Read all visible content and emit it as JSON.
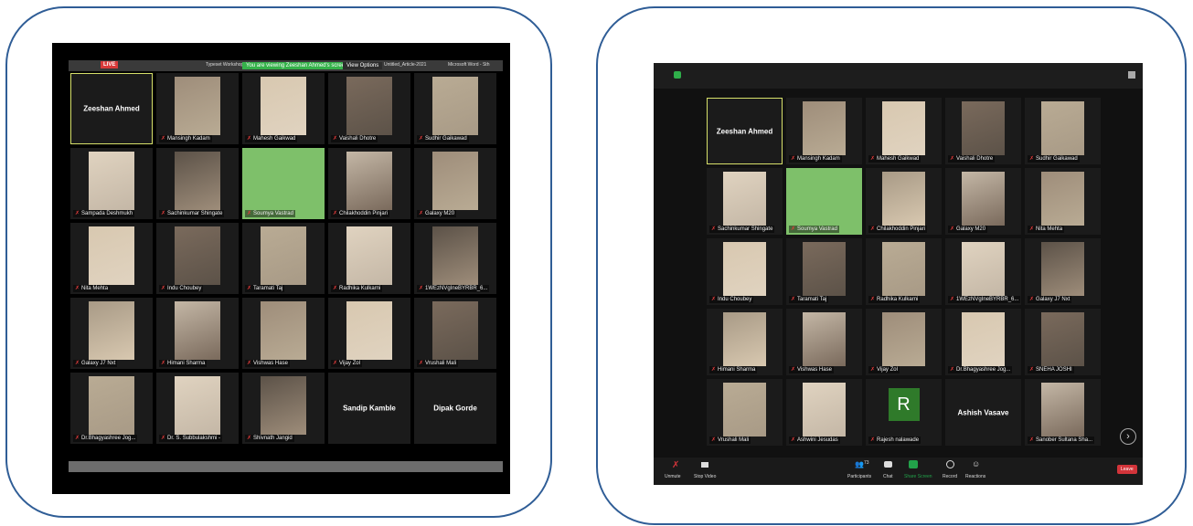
{
  "left": {
    "browser_tabs": [
      "LIVE",
      "Typeset Workshop",
      "Untitled_Article-2021",
      "Microsoft Word - Sth"
    ],
    "share_banner": "You are viewing Zeeshan Ahmed's screen",
    "view_options": "View Options",
    "tiles": [
      {
        "label": "Zeeshan Ahmed",
        "type": "name"
      },
      {
        "label": "Mansingh Kadam",
        "type": "video"
      },
      {
        "label": "Mahesh Gaikwad",
        "type": "video"
      },
      {
        "label": "Vaishali Dhotre",
        "type": "video"
      },
      {
        "label": "Sudhir Gaikawad",
        "type": "video"
      },
      {
        "label": "Sampada Deshmukh",
        "type": "video"
      },
      {
        "label": "Sachinkumar Shingate",
        "type": "video"
      },
      {
        "label": "Soumya Vastrad",
        "type": "green"
      },
      {
        "label": "Chilakhoddin Pinjari",
        "type": "video"
      },
      {
        "label": "Galaxy M20",
        "type": "video"
      },
      {
        "label": "Nita Mehta",
        "type": "video"
      },
      {
        "label": "Indu Choubey",
        "type": "video"
      },
      {
        "label": "Taramati Taj",
        "type": "video"
      },
      {
        "label": "Radhika Kulkarni",
        "type": "video"
      },
      {
        "label": "1WEzNVgIneBYRBR_6...",
        "type": "video"
      },
      {
        "label": "Galaxy J7 Nxt",
        "type": "video"
      },
      {
        "label": "Himani Sharma",
        "type": "video"
      },
      {
        "label": "Vishwas Hase",
        "type": "video"
      },
      {
        "label": "Vijay Zol",
        "type": "video"
      },
      {
        "label": "Vrushali Mali",
        "type": "video"
      },
      {
        "label": "Dr.Bhagyashree Jog...",
        "type": "video"
      },
      {
        "label": "Dr. S. Subbulakshmi -",
        "type": "video"
      },
      {
        "label": "Shivnath Jangid",
        "type": "video"
      },
      {
        "label": "Sandip Kamble",
        "type": "name"
      },
      {
        "label": "Dipak Gorde",
        "type": "name"
      }
    ]
  },
  "right": {
    "tiles": [
      {
        "label": "Zeeshan Ahmed",
        "type": "name"
      },
      {
        "label": "Mansingh Kadam",
        "type": "video"
      },
      {
        "label": "Mahesh Gaikwad",
        "type": "video"
      },
      {
        "label": "Vaishali Dhotre",
        "type": "video"
      },
      {
        "label": "Sudhir Gaikawad",
        "type": "video"
      },
      {
        "label": "Sachinkumar Shingate",
        "type": "video"
      },
      {
        "label": "Soumya Vastrad",
        "type": "green"
      },
      {
        "label": "Chilakhoddin Pinjari",
        "type": "video"
      },
      {
        "label": "Galaxy M20",
        "type": "video"
      },
      {
        "label": "Nita Mehta",
        "type": "video"
      },
      {
        "label": "Indu Choubey",
        "type": "video"
      },
      {
        "label": "Taramati Taj",
        "type": "video"
      },
      {
        "label": "Radhika Kulkarni",
        "type": "video"
      },
      {
        "label": "1WEzNVgIneBYRBR_6...",
        "type": "video"
      },
      {
        "label": "Galaxy J7 Nxt",
        "type": "video"
      },
      {
        "label": "Himani Sharma",
        "type": "video"
      },
      {
        "label": "Vishwas Hase",
        "type": "video"
      },
      {
        "label": "Vijay Zol",
        "type": "video"
      },
      {
        "label": "Dr.Bhagyashree Jog...",
        "type": "video"
      },
      {
        "label": "SNEHA JOSHI",
        "type": "video"
      },
      {
        "label": "Vrushali Mali",
        "type": "video"
      },
      {
        "label": "Ashwini Jesudas",
        "type": "video"
      },
      {
        "label": "Rajesh nalawade",
        "type": "avatar",
        "initial": "R"
      },
      {
        "label": "Ashish Vasave",
        "type": "name"
      },
      {
        "label": "Sanober Sultana Sha...",
        "type": "video"
      }
    ],
    "toolbar": {
      "unmute": "Unmute",
      "stop_video": "Stop Video",
      "participants": "Participants",
      "participants_count": "73",
      "chat": "Chat",
      "share_screen": "Share Screen",
      "record": "Record",
      "reactions": "Reactions",
      "leave": "Leave"
    },
    "colors": {
      "share_green": "#22a24a",
      "leave_red": "#d2343a",
      "toolbar_bg": "#1a1a1a"
    }
  }
}
